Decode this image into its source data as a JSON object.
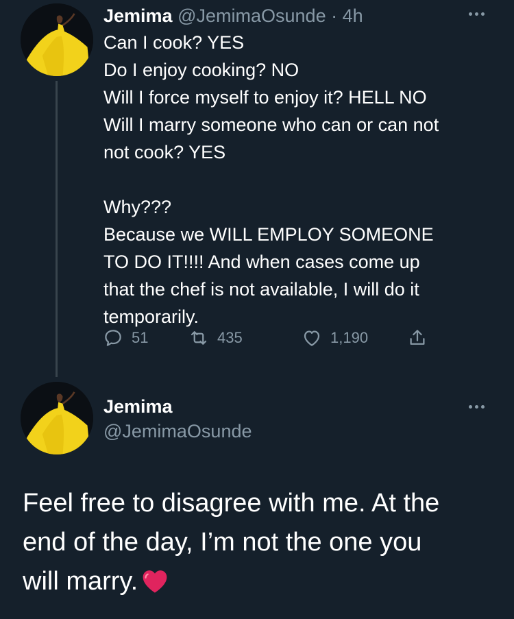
{
  "tweet1": {
    "name": "Jemima",
    "handle": "@JemimaOsunde",
    "separator": "·",
    "time": "4h",
    "lines": [
      "Can I cook? YES",
      "Do I enjoy cooking? NO",
      "Will I force myself to enjoy it? HELL NO",
      "Will I marry someone who can or can not",
      "not cook? YES",
      "",
      "Why???",
      "Because we WILL EMPLOY SOMEONE",
      "TO DO IT!!!! And when cases come up",
      "that the chef is not available, I will do it",
      "temporarily."
    ],
    "actions": {
      "reply_count": "51",
      "retweet_count": "435",
      "like_count": "1,190"
    }
  },
  "tweet2": {
    "name": "Jemima",
    "handle": "@JemimaOsunde",
    "lines": [
      "Feel free to disagree with me. At the",
      "end of the day, I’m not the one you",
      "will marry."
    ]
  },
  "icons": {
    "reply": "reply-icon",
    "retweet": "retweet-icon",
    "like": "heart-outline-icon",
    "share": "share-icon",
    "more": "more-dots-icon",
    "emoji": "red-heart-emoji"
  },
  "colors": {
    "background": "#15202b",
    "secondary_text": "#8899a6",
    "thread_line": "#38444d",
    "heart_emoji": "#e0245e"
  }
}
